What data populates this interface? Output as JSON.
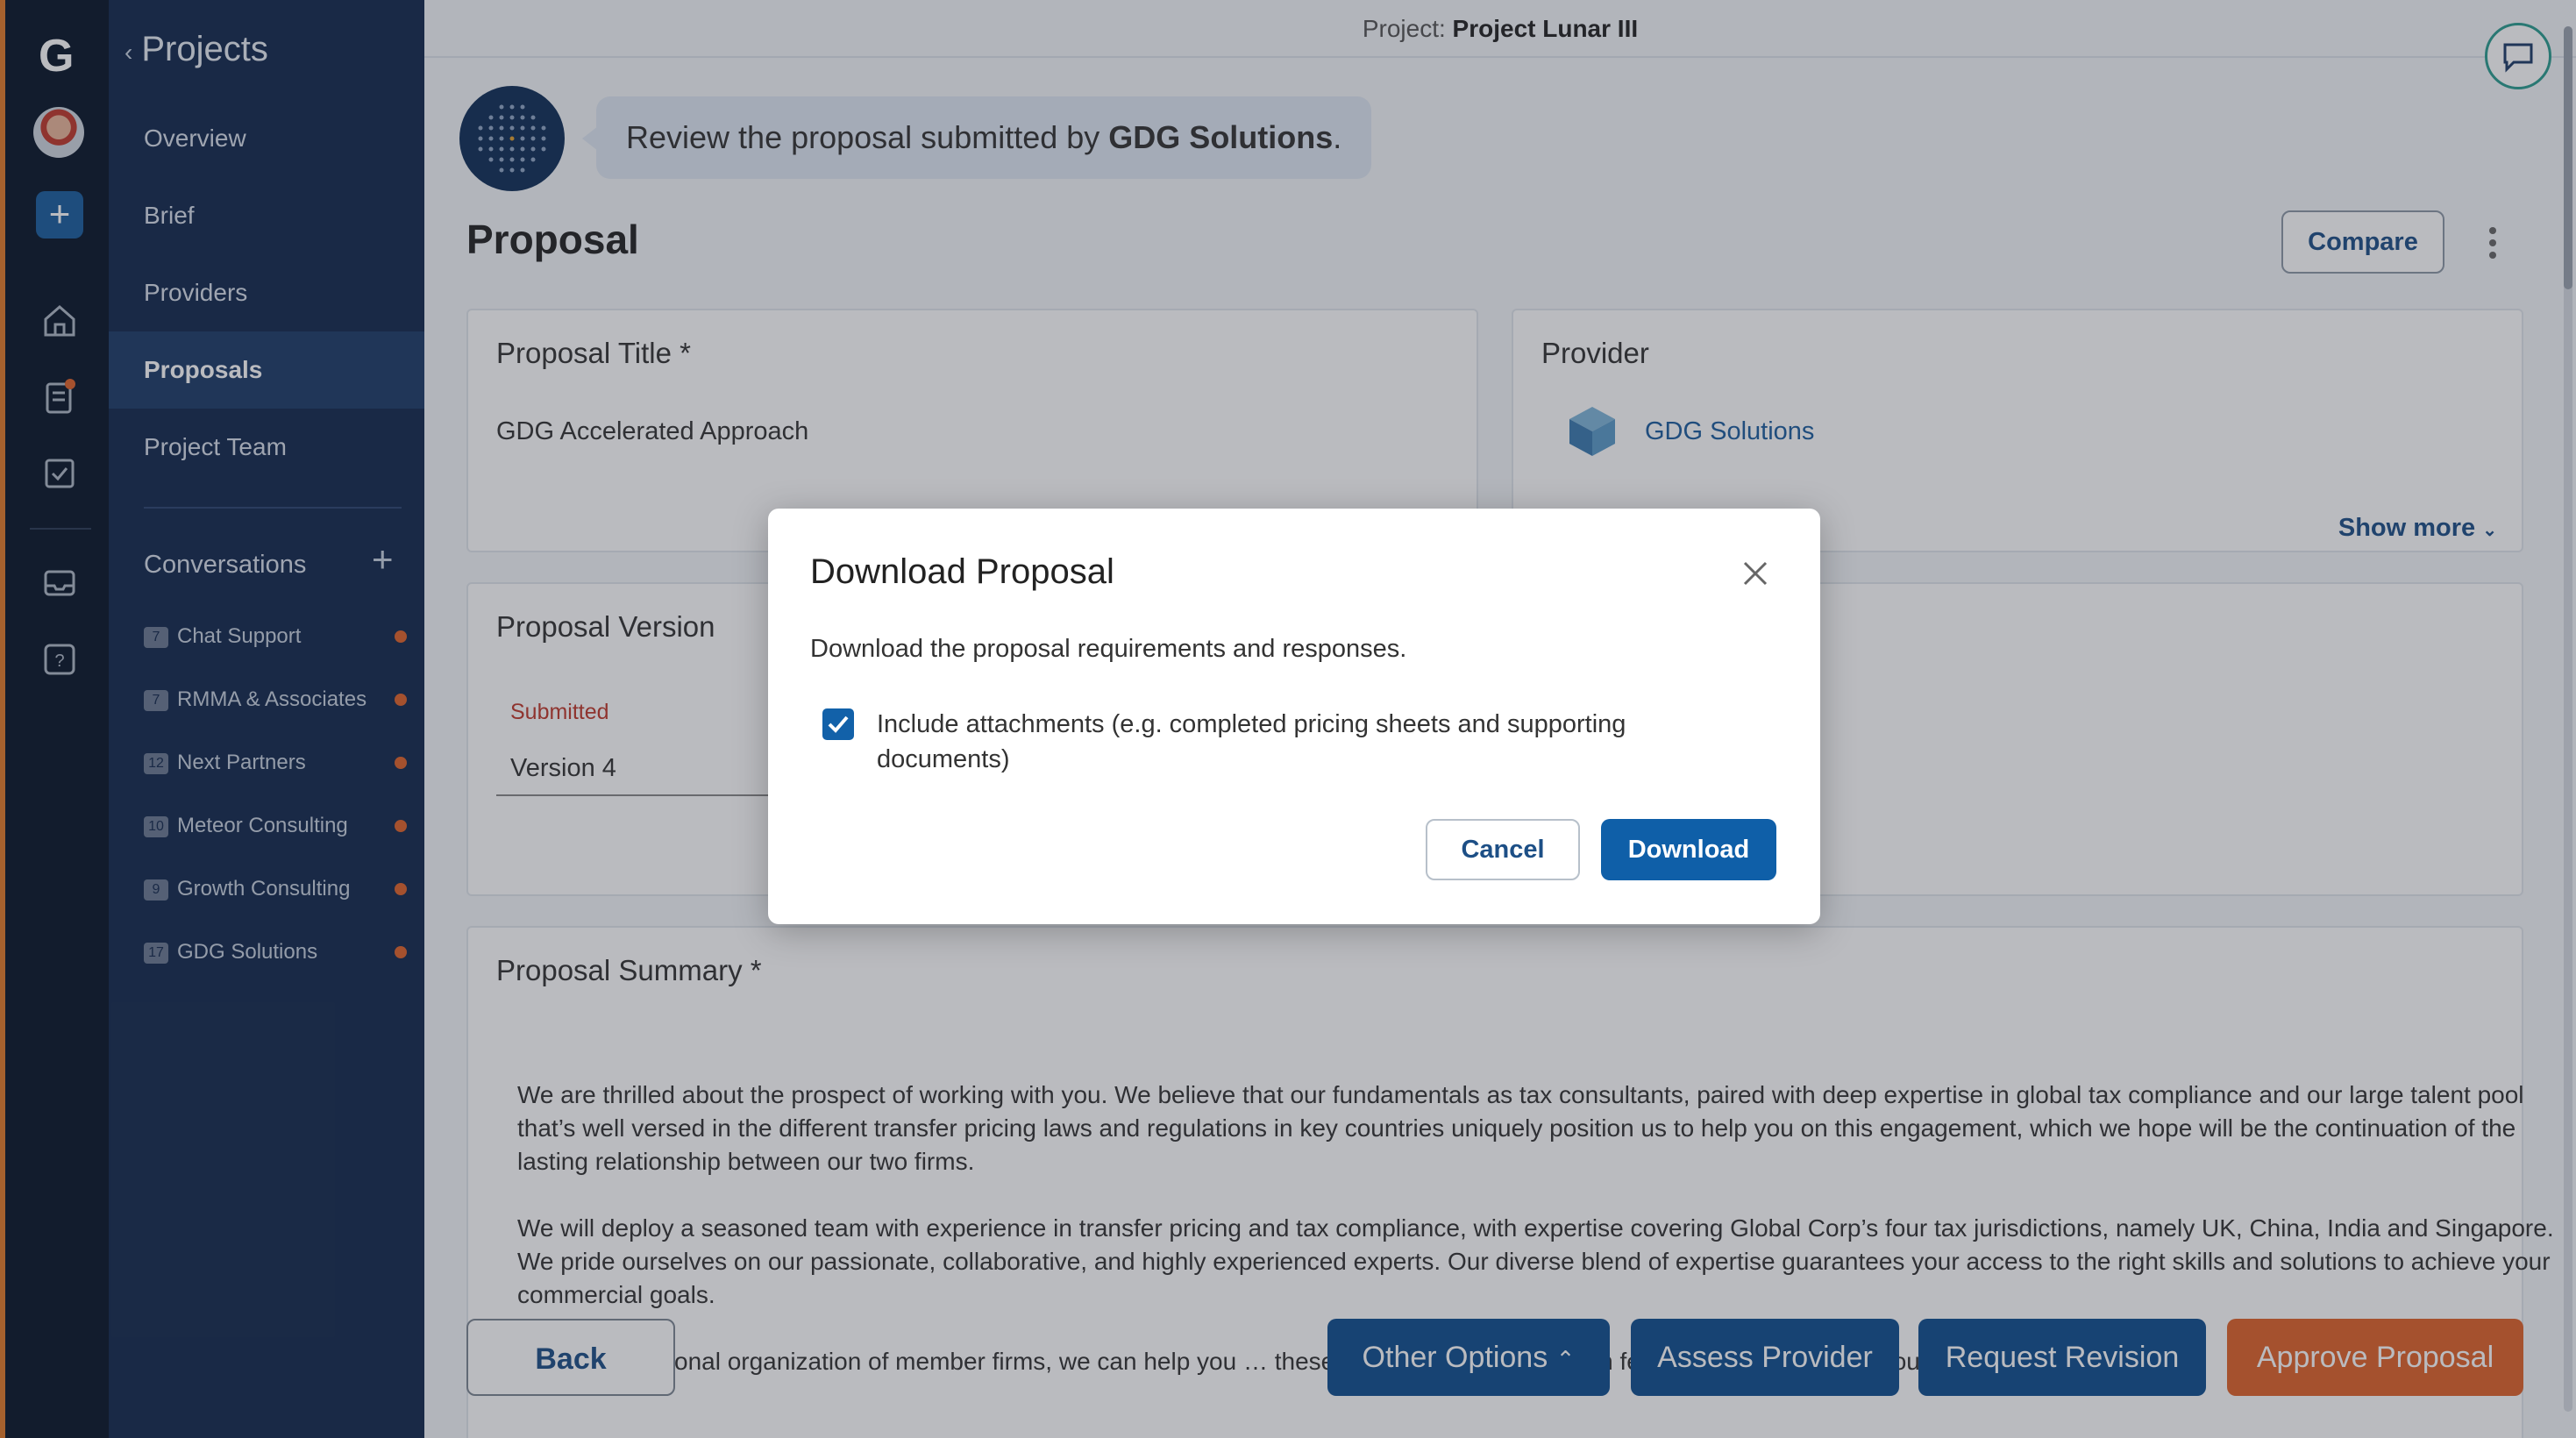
{
  "rail": {
    "logo_letter": "G",
    "items": [
      "avatar",
      "add-icon",
      "home-icon",
      "clipboard-icon",
      "checklist-icon",
      "inbox-icon",
      "help-icon"
    ]
  },
  "sidebar": {
    "back_label": "Projects",
    "nav": [
      {
        "label": "Overview"
      },
      {
        "label": "Brief"
      },
      {
        "label": "Providers"
      },
      {
        "label": "Proposals",
        "active": true
      },
      {
        "label": "Project Team"
      }
    ],
    "conversations_label": "Conversations",
    "conversations": [
      {
        "count": "7",
        "name": "Chat Support"
      },
      {
        "count": "7",
        "name": "RMMA & Associates"
      },
      {
        "count": "12",
        "name": "Next Partners"
      },
      {
        "count": "10",
        "name": "Meteor Consulting"
      },
      {
        "count": "9",
        "name": "Growth Consulting"
      },
      {
        "count": "17",
        "name": "GDG Solutions"
      }
    ]
  },
  "header": {
    "project_prefix": "Project:",
    "project_name": "Project Lunar III"
  },
  "assistant": {
    "message_prefix": "Review the proposal submitted by",
    "message_bold": "GDG Solutions",
    "message_suffix": "."
  },
  "main": {
    "page_title": "Proposal",
    "compare_label": "Compare",
    "proposal_title_heading": "Proposal Title *",
    "proposal_title_value": "GDG Accelerated Approach",
    "provider_heading": "Provider",
    "provider_name": "GDG Solutions",
    "show_more_label": "Show more",
    "version_heading": "Proposal Version",
    "version_status": "Submitted",
    "version_value": "Version 4",
    "summary_heading": "Proposal Summary *",
    "summary_paragraphs": [
      "We are thrilled about the prospect of working with you. We believe that our fundamentals as tax consultants, paired with deep expertise in global tax compliance and our large talent pool that’s well versed in the different transfer pricing laws and regulations in key countries uniquely position us to help you on this engagement, which we hope will be the continuation of the lasting relationship between our two firms.",
      "We will deploy a seasoned team with experience in transfer pricing and tax compliance, with expertise covering Global Corp’s four tax jurisdictions, namely UK, China, India and Singapore. We pride ourselves on our passionate, collaborative, and highly experienced experts. Our diverse blend of expertise guarantees your access to the right skills and solutions to achieve your commercial goals.",
      "As an international organization of member firms, we can help you … these laws may share common features across various countries …"
    ]
  },
  "footer": {
    "back_label": "Back",
    "other_options_label": "Other Options",
    "assess_label": "Assess Provider",
    "revision_label": "Request Revision",
    "approve_label": "Approve Proposal"
  },
  "dialog": {
    "title": "Download Proposal",
    "description": "Download the proposal requirements and responses.",
    "checkbox_label": "Include attachments (e.g. completed pricing sheets and supporting documents)",
    "checkbox_checked": true,
    "cancel_label": "Cancel",
    "download_label": "Download"
  },
  "colors": {
    "brand_blue": "#0f4f8f",
    "approve_orange": "#e0632a",
    "sidebar_bg": "#13294d",
    "rail_bg": "#081528"
  }
}
